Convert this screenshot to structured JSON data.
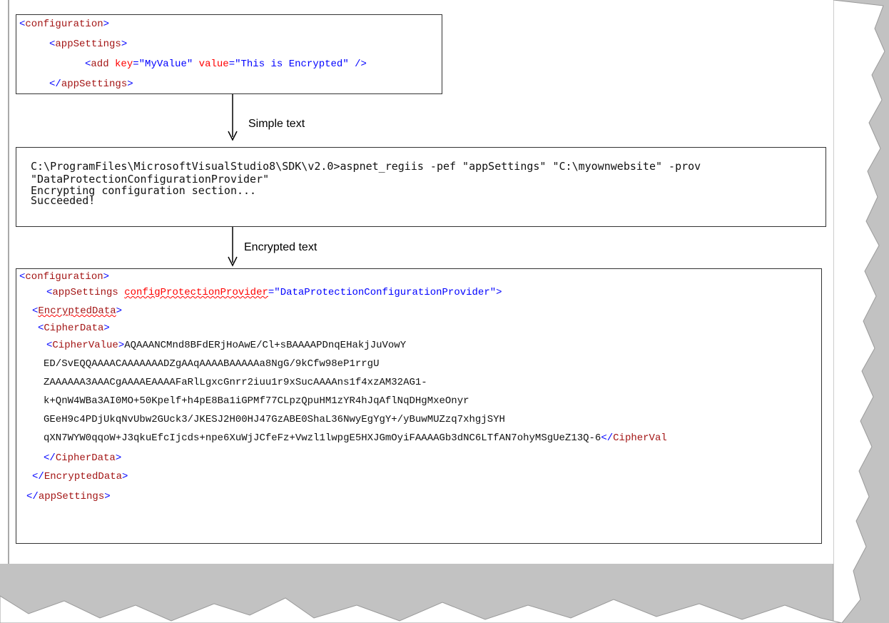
{
  "box1": {
    "lines": [
      [
        [
          "p",
          "<"
        ],
        [
          "t",
          "configuration"
        ],
        [
          "p",
          ">"
        ]
      ],
      [
        [
          "p",
          "<"
        ],
        [
          "t",
          "appSettings"
        ],
        [
          "p",
          ">"
        ]
      ],
      [
        [
          "p",
          "<"
        ],
        [
          "t",
          "add "
        ],
        [
          "a",
          "key"
        ],
        [
          "p",
          "=\""
        ],
        [
          "v",
          "MyValue"
        ],
        [
          "p",
          "\" "
        ],
        [
          "a",
          "value"
        ],
        [
          "p",
          "=\""
        ],
        [
          "v",
          "This is Encrypted"
        ],
        [
          "p",
          "\" />"
        ]
      ],
      [
        [
          "p",
          "</"
        ],
        [
          "t",
          "appSettings"
        ],
        [
          "p",
          ">"
        ]
      ]
    ]
  },
  "label1": "Simple text",
  "box2": {
    "lines": [
      "C:\\ProgramFiles\\MicrosoftVisualStudio8\\SDK\\v2.0>aspnet_regiis -pef \"appSettings\" \"C:\\myownwebsite\" -prov",
      "\"DataProtectionConfigurationProvider\"",
      "Encrypting configuration section...",
      "Succeeded!"
    ]
  },
  "label2": "Encrypted text",
  "box3": {
    "lines": [
      [
        [
          "p",
          "<"
        ],
        [
          "t",
          "configuration"
        ],
        [
          "p",
          ">"
        ]
      ],
      [
        [
          "p",
          "<"
        ],
        [
          "t",
          "appSettings "
        ],
        [
          "as",
          "configProtectionProvider"
        ],
        [
          "p",
          "=\""
        ],
        [
          "v",
          "DataProtectionConfigurationProvider"
        ],
        [
          "p",
          "\">"
        ]
      ],
      [
        [
          "p",
          "<"
        ],
        [
          "ts",
          "EncryptedData"
        ],
        [
          "p",
          ">"
        ]
      ],
      [
        [
          "p",
          "<"
        ],
        [
          "t",
          "CipherData"
        ],
        [
          "p",
          ">"
        ]
      ],
      [
        [
          "p",
          "<"
        ],
        [
          "t",
          "CipherValue"
        ],
        [
          "p",
          ">"
        ],
        [
          "plain",
          "AQAAANCMnd8BFdERjHoAwE/Cl+sBAAAAPDnqEHakjJuVowY"
        ]
      ],
      [
        [
          "plain",
          "ED/SvEQQAAAACAAAAAAADZgAAqAAAABAAAAAa8NgG/9kCfw98eP1rrgU"
        ]
      ],
      [
        [
          "plain",
          "ZAAAAAA3AAACgAAAAEAAAAFaRlLgxcGnrr2iuu1r9xSucAAAAns1f4xzAM32AG1-"
        ]
      ],
      [
        [
          "plain",
          "k+QnW4WBa3AI0MO+50Kpelf+h4pE8Ba1iGPMf77CLpzQpuHM1zYR4hJqAflNqDHgMxeOnyr"
        ]
      ],
      [
        [
          "plain",
          "GEeH9c4PDjUkqNvUbw2GUck3/JKESJ2H00HJ47GzABE0ShaL36NwyEgYgY+/yBuwMUZzq7xhgjSYH"
        ]
      ],
      [
        [
          "plain",
          "qXN7WYW0qqoW+J3qkuEfcIjcds+npe6XuWjJCfeFz+Vwzl1lwpgE5HXJGmOyiFAAAAGb3dNC6LTfAN7ohyMSgUeZ13Q-6"
        ],
        [
          "p",
          "</"
        ],
        [
          "t",
          "CipherVal"
        ]
      ],
      [
        [
          "p",
          "</"
        ],
        [
          "t",
          "CipherData"
        ],
        [
          "p",
          ">"
        ]
      ],
      [
        [
          "p",
          "</"
        ],
        [
          "t",
          "EncryptedData"
        ],
        [
          "p",
          ">"
        ]
      ],
      [
        [
          "p",
          "</"
        ],
        [
          "t",
          "appSettings"
        ],
        [
          "p",
          ">"
        ]
      ]
    ]
  },
  "colors": {
    "tag": "#a31515",
    "punct": "#0000ff",
    "attr": "#ff0000",
    "value": "#0000ff",
    "paper_shadow": "#c0c0c0",
    "torn_edge": "#e5e5e5"
  }
}
